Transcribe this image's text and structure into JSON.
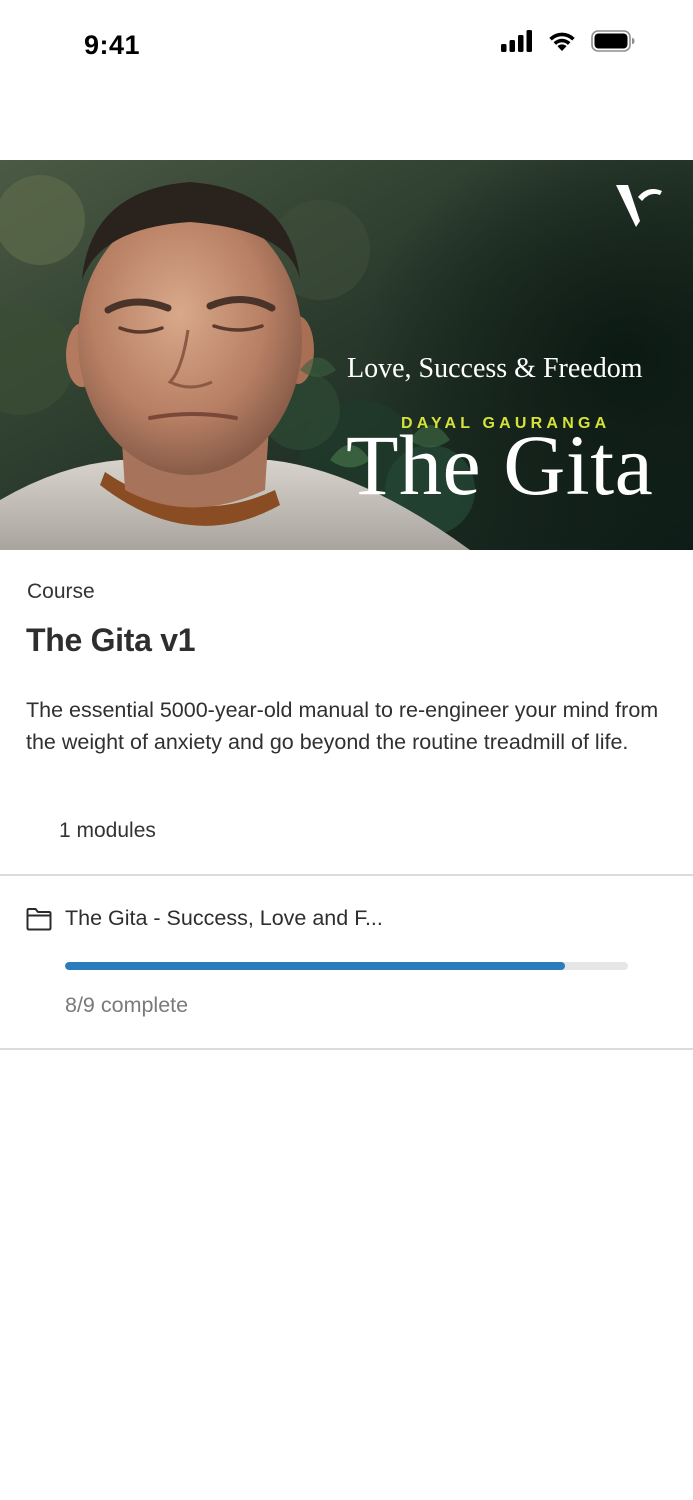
{
  "status_bar": {
    "time": "9:41",
    "icons": [
      "cellular-signal-icon",
      "wifi-icon",
      "battery-icon"
    ]
  },
  "hero": {
    "title": "The Gita",
    "subtitle": "Love, Success & Freedom",
    "author": "DAYAL GAURANGA",
    "logo": "V",
    "author_color": "#d6e23a"
  },
  "course": {
    "type": "Course",
    "title": "The Gita v1",
    "description": "The essential 5000-year-old manual to re-engineer your mind from the weight of anxiety and go beyond the routine treadmill of life.",
    "modules_count": "1 modules"
  },
  "modules": [
    {
      "icon": "folder-icon",
      "title": "The Gita - Success, Love and F...",
      "progress_text": "8/9 complete",
      "completed": 8,
      "total": 9
    }
  ],
  "colors": {
    "accent": "#2b7bbd",
    "progress_track": "#e6e6e6",
    "divider": "#dcdcdc"
  }
}
